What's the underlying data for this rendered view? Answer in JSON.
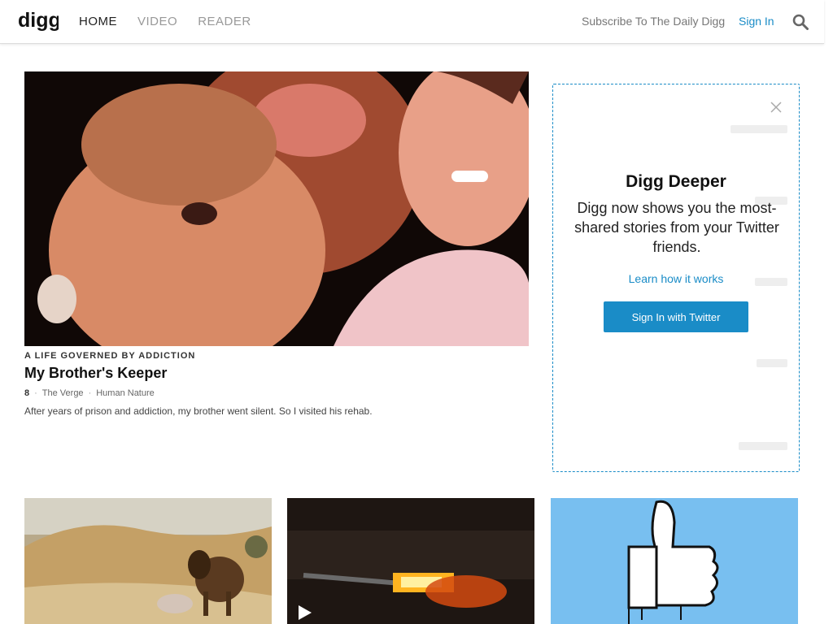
{
  "header": {
    "logo": "digg",
    "nav": [
      "HOME",
      "VIDEO",
      "READER"
    ],
    "subscribe": "Subscribe To The Daily Digg",
    "signin": "Sign In",
    "search_icon": "search-icon"
  },
  "hero": {
    "kicker": "A LIFE GOVERNED BY ADDICTION",
    "title": "My Brother's Keeper",
    "diggs": "8",
    "source": "The Verge",
    "category": "Human Nature",
    "description": "After years of prison and addiction, my brother went silent. So I visited his rehab."
  },
  "promo": {
    "title": "Digg Deeper",
    "body": "Digg now shows you the most-shared stories from your Twitter friends.",
    "learn": "Learn how it works",
    "button": "Sign In with Twitter",
    "close_icon": "close-icon"
  },
  "colors": {
    "accent": "#1a8cc7",
    "card3_bg": "#78bff0"
  }
}
